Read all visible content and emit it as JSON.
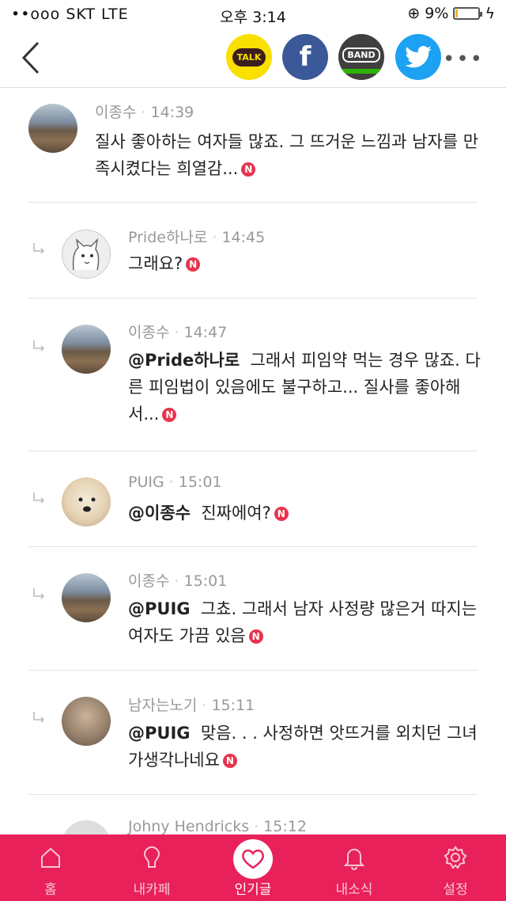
{
  "status_bar": {
    "carrier": "••ooo SKT  LTE",
    "time": "오후 3:14",
    "battery": "9%",
    "battery_level": 0.09
  },
  "toolbar": {
    "share_kakao": "TALK",
    "share_facebook": "f",
    "share_band": "BAND",
    "more": "•••"
  },
  "comments": [
    {
      "author": "이종수",
      "time": "14:39",
      "mention": "",
      "text": "질사 좋아하는 여자들 많죠. 그 뜨거운 느낌과 남자를 만족시켰다는 희열감...",
      "badge": "N",
      "is_reply": false,
      "avatar": "railroad-avatar"
    },
    {
      "author": "Pride하나로",
      "time": "14:45",
      "mention": "",
      "text": "그래요?",
      "badge": "N",
      "is_reply": true,
      "avatar": "cat-avatar"
    },
    {
      "author": "이종수",
      "time": "14:47",
      "mention": "@Pride하나로",
      "text": "그래서 피임약 먹는 경우 많죠. 다른 피임법이 있음에도 불구하고... 질사를 좋아해서...",
      "badge": "N",
      "is_reply": true,
      "avatar": "railroad-avatar"
    },
    {
      "author": "PUIG",
      "time": "15:01",
      "mention": "@이종수",
      "text": "진짜에여?",
      "badge": "N",
      "is_reply": true,
      "avatar": "dog-avatar"
    },
    {
      "author": "이종수",
      "time": "15:01",
      "mention": "@PUIG",
      "text": "그쵸. 그래서 남자 사정량 많은거 따지는 여자도 가끔 있음",
      "badge": "N",
      "is_reply": true,
      "avatar": "railroad-avatar"
    },
    {
      "author": "남자는노기",
      "time": "15:11",
      "mention": "@PUIG",
      "text": "맞음. . . 사정하면 앗뜨거를 외치던 그녀가생각나네요",
      "badge": "N",
      "is_reply": true,
      "avatar": "man-avatar"
    },
    {
      "author": "Johny Hendricks",
      "time": "15:12",
      "mention": "",
      "text": "",
      "badge": "",
      "is_reply": true,
      "avatar": "user-avatar"
    }
  ],
  "tabbar": {
    "items": [
      {
        "label": "홈",
        "icon": "home-icon",
        "active": false
      },
      {
        "label": "내카페",
        "icon": "my-cafe-icon",
        "active": false
      },
      {
        "label": "인기글",
        "icon": "heart-icon",
        "active": true
      },
      {
        "label": "내소식",
        "icon": "bell-icon",
        "active": false
      },
      {
        "label": "설정",
        "icon": "gear-icon",
        "active": false
      }
    ]
  }
}
